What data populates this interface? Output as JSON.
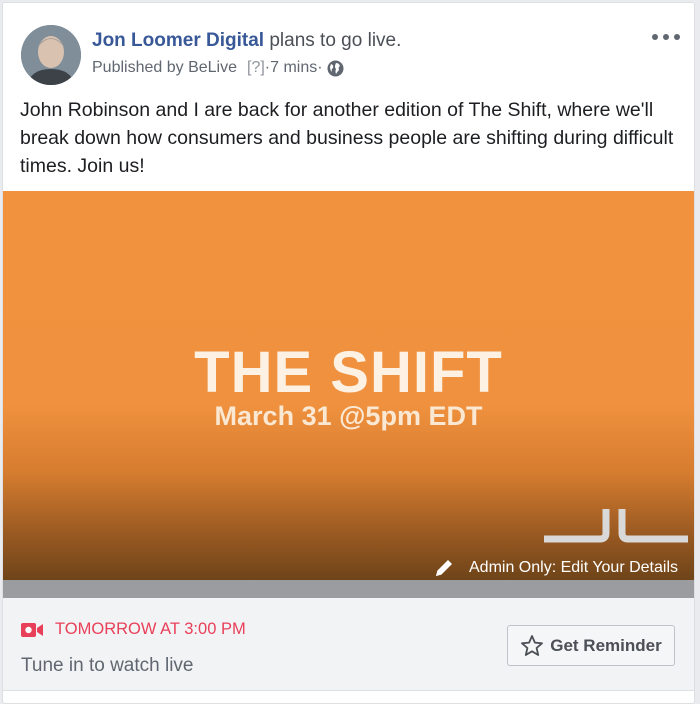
{
  "post": {
    "page_name": "Jon Loomer Digital",
    "action_text": "plans to go live.",
    "published_by_label": "Published by",
    "app_name": "BeLive",
    "app_help": "[?]",
    "separator_1": "·",
    "time_ago": "7 mins",
    "separator_2": "·",
    "privacy_icon": "globe-icon",
    "more_icon": "more-horizontal-icon",
    "body": "John Robinson and I are back for another edition of The Shift, where we'll break down how consumers and business people are shifting during difficult times. Join us!"
  },
  "banner": {
    "title": "THE SHIFT",
    "subtitle": "March 31 @5pm EDT",
    "logo_icon": "jl-logo-icon",
    "admin_edit_label": "Admin Only: Edit Your Details",
    "edit_icon": "pencil-icon"
  },
  "live": {
    "schedule_icon": "live-video-icon",
    "schedule_text": "TOMORROW AT 3:00 PM",
    "tune_in_text": "Tune in to watch live",
    "reminder_icon": "star-icon",
    "reminder_label": "Get Reminder"
  },
  "colors": {
    "link_blue": "#385898",
    "live_red": "#e9405a",
    "banner_orange": "#f0923e"
  }
}
